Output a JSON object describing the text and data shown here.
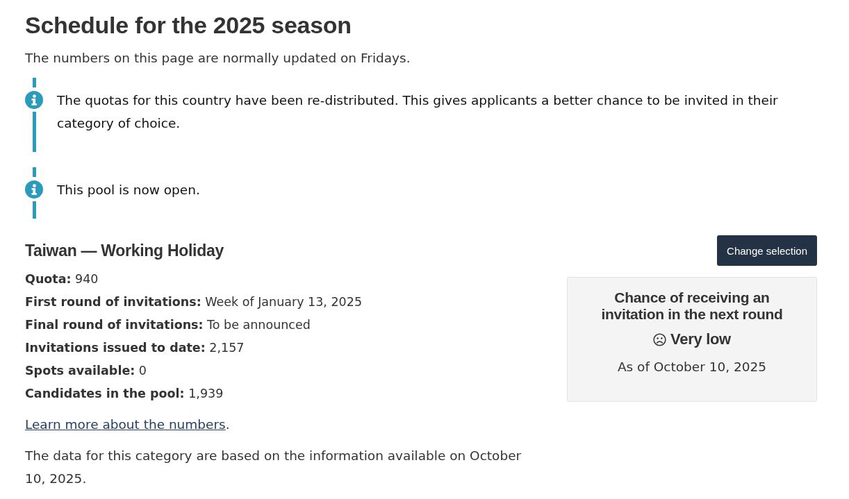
{
  "page": {
    "title": "Schedule for the 2025 season",
    "intro": "The numbers on this page are normally updated on Fridays."
  },
  "notices": [
    {
      "kind": "info",
      "text": "The quotas for this country have been re-distributed. This gives applicants a better chance to be invited in their category of choice."
    },
    {
      "kind": "info",
      "text": "This pool is now open."
    }
  ],
  "category": {
    "heading": "Taiwan — Working Holiday",
    "button": "Change selection",
    "facts": [
      {
        "label": "Quota:",
        "value": "940"
      },
      {
        "label": "First round of invitations:",
        "value": "Week of January 13, 2025"
      },
      {
        "label": "Final round of invitations:",
        "value": "To be announced"
      },
      {
        "label": "Invitations issued to date:",
        "value": "2,157"
      },
      {
        "label": "Spots available:",
        "value": "0"
      },
      {
        "label": "Candidates in the pool:",
        "value": "1,939"
      }
    ],
    "link": {
      "text": "Learn more about the numbers",
      "after": "."
    },
    "note": "The data for this category are based on the information available on October 10, 2025."
  },
  "chance_card": {
    "title": "Chance of receiving an invitation in the next round",
    "rating": "Very low",
    "as_of": "As of October 10, 2025"
  }
}
